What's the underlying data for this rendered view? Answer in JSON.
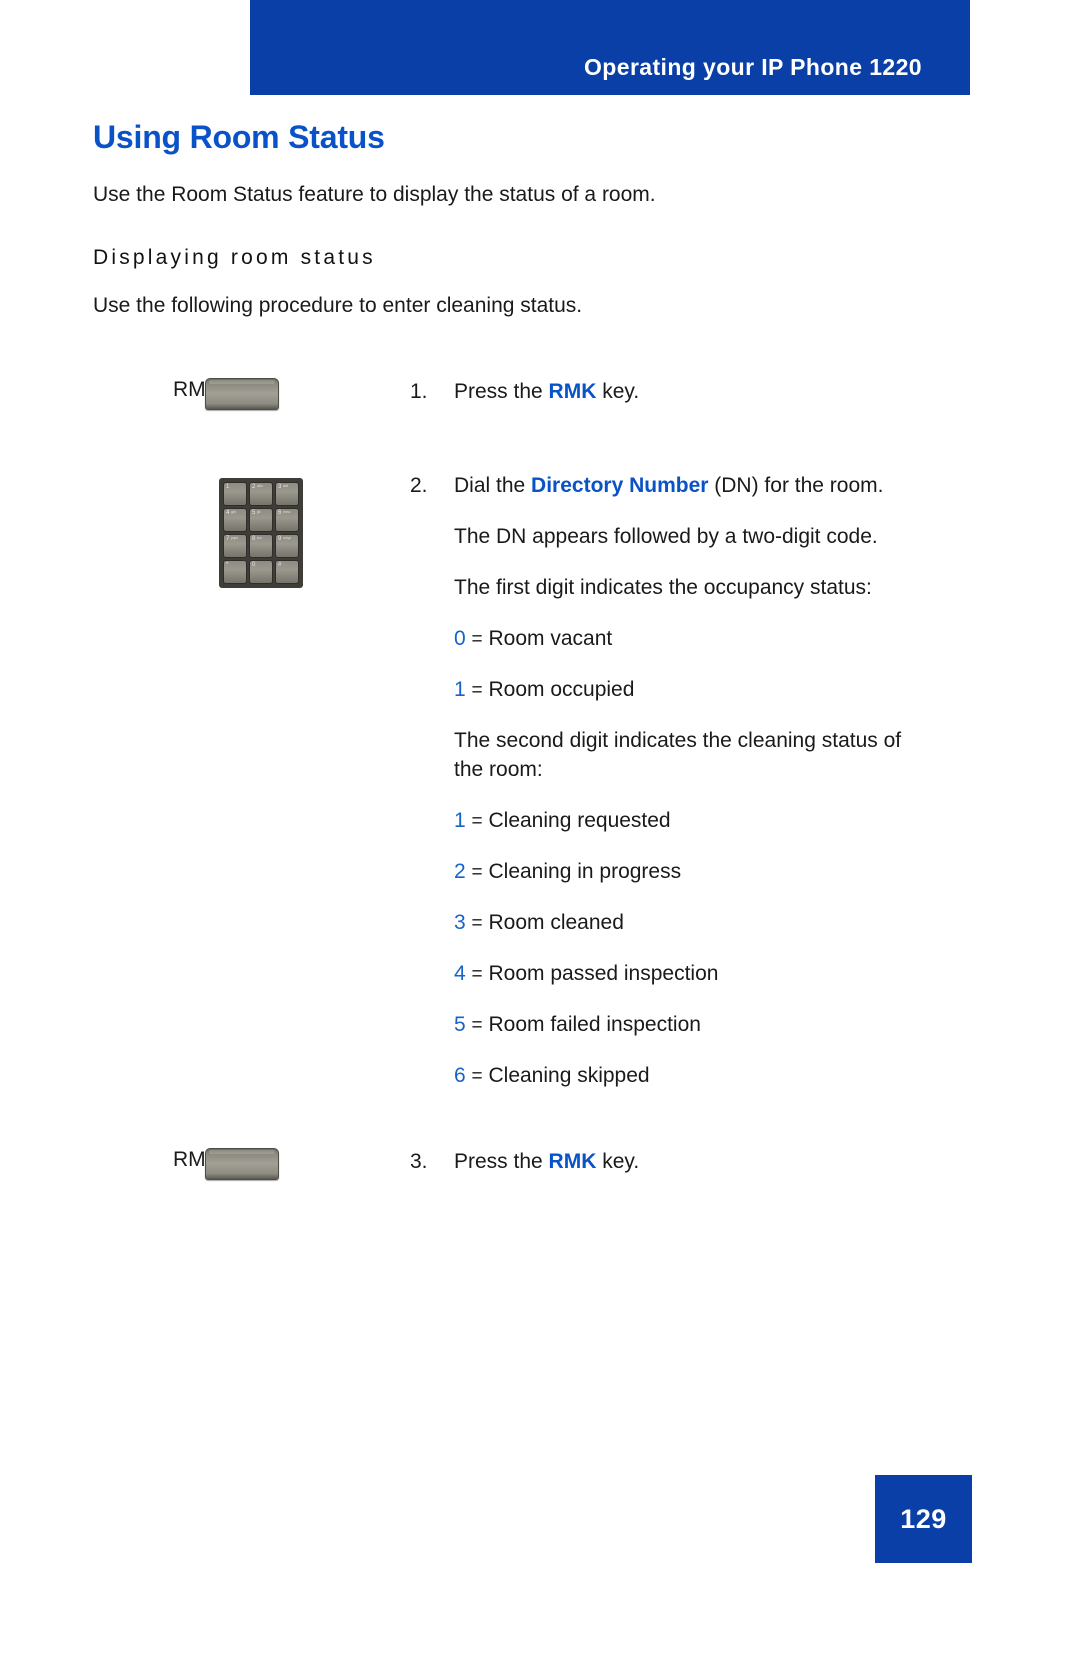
{
  "header": {
    "title": "Operating your IP Phone 1220",
    "bg_color": "#0a3fa8",
    "text_color": "#ffffff"
  },
  "page": {
    "title": "Using Room Status",
    "title_color": "#0a52c8",
    "intro": "Use the Room Status feature to display the status of a room.",
    "section_heading": "Displaying room status",
    "section_intro": "Use the following procedure to enter cleaning status."
  },
  "steps": [
    {
      "number": "1.",
      "key_label": "RMK",
      "art": "hardkey",
      "text_before": "Press the ",
      "keyword": "RMK",
      "text_after": " key."
    },
    {
      "number": "2.",
      "key_label": "",
      "art": "keypad",
      "text_before": "Dial the ",
      "keyword": "Directory Number",
      "text_after": " (DN) for the room.",
      "paragraphs": [
        "The DN appears followed by a two-digit code.",
        "The first digit indicates the occupancy status:"
      ],
      "occupancy_codes": [
        {
          "digit": "0",
          "eq": "=",
          "label": "Room vacant"
        },
        {
          "digit": "1",
          "eq": "=",
          "label": "Room occupied"
        }
      ],
      "cleaning_intro": "The second digit indicates the cleaning status of the room:",
      "cleaning_codes": [
        {
          "digit": "1",
          "eq": "=",
          "label": "Cleaning requested"
        },
        {
          "digit": "2",
          "eq": "=",
          "label": "Cleaning in progress"
        },
        {
          "digit": "3",
          "eq": "=",
          "label": "Room cleaned"
        },
        {
          "digit": "4",
          "eq": "=",
          "label": "Room passed inspection"
        },
        {
          "digit": "5",
          "eq": "=",
          "label": "Room failed inspection"
        },
        {
          "digit": "6",
          "eq": "=",
          "label": "Cleaning skipped"
        }
      ]
    },
    {
      "number": "3.",
      "key_label": "RMK",
      "art": "hardkey",
      "text_before": "Press the ",
      "keyword": "RMK",
      "text_after": " key."
    }
  ],
  "keypad": {
    "keys": [
      {
        "num": "1",
        "alpha": ""
      },
      {
        "num": "2",
        "alpha": "abc"
      },
      {
        "num": "3",
        "alpha": "def"
      },
      {
        "num": "4",
        "alpha": "ghi"
      },
      {
        "num": "5",
        "alpha": "jkl"
      },
      {
        "num": "6",
        "alpha": "mno"
      },
      {
        "num": "7",
        "alpha": "pqrs"
      },
      {
        "num": "8",
        "alpha": "tuv"
      },
      {
        "num": "9",
        "alpha": "wxyz"
      },
      {
        "num": "*",
        "alpha": ""
      },
      {
        "num": "0",
        "alpha": ""
      },
      {
        "num": "#",
        "alpha": ""
      }
    ]
  },
  "footer": {
    "page_number": "129",
    "bg_color": "#0a3fa8"
  },
  "colors": {
    "brand_blue": "#0a3fa8",
    "accent_blue": "#0a52c8",
    "digit_blue": "#1763c6",
    "body_text": "#1a1a1a"
  }
}
